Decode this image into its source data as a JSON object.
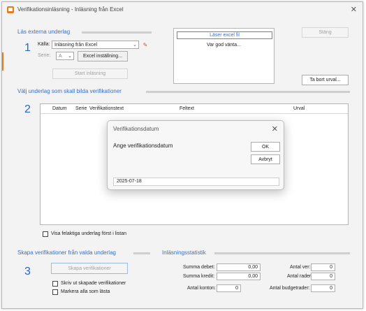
{
  "window": {
    "title": "Verifikationsinläsning - Inläsning från Excel"
  },
  "section1": {
    "title": "Läs externa underlag",
    "step": "1",
    "source_label": "Källa:",
    "source_value": "Inläsning från Excel",
    "series_label": "Serie:",
    "series_value": "A",
    "excel_settings_button": "Excel inställning...",
    "start_button": "Start inläsning"
  },
  "reader": {
    "status_header": "Läser excel fil",
    "status_text": "Var god vänta..."
  },
  "close_button": "Stäng",
  "remove_selection_button": "Ta bort urval...",
  "section2": {
    "title": "Välj underlag som skall bilda verifikationer",
    "step": "2",
    "columns": [
      "Datum",
      "Serie",
      "Verifikationstext",
      "Feltext",
      "Urval"
    ],
    "show_faulty_label": "Visa felaktiga underlag först i listan"
  },
  "section3": {
    "title": "Skapa verifikationer från valda underlag",
    "step": "3",
    "create_button": "Skapa verifikationer",
    "print_label": "Skriv ut skapade verifikationer",
    "mark_read_label": "Markera alla som lästa"
  },
  "stats": {
    "title": "Inläsningsstatistik",
    "sum_debit_label": "Summa debet:",
    "sum_debit_value": "0,00",
    "sum_credit_label": "Summa kredit:",
    "sum_credit_value": "0,00",
    "accounts_label": "Antal konton:",
    "accounts_value": "0",
    "ver_label": "Antal ver:",
    "ver_value": "0",
    "rows_label": "Antal rader:",
    "rows_value": "0",
    "budget_rows_label": "Antal budgetrader:",
    "budget_rows_value": "0"
  },
  "dialog": {
    "title": "Verifikationsdatum",
    "prompt": "Ange verifikationsdatum",
    "ok_button": "OK",
    "cancel_button": "Avbryt",
    "date_value": "2025-07-18"
  }
}
